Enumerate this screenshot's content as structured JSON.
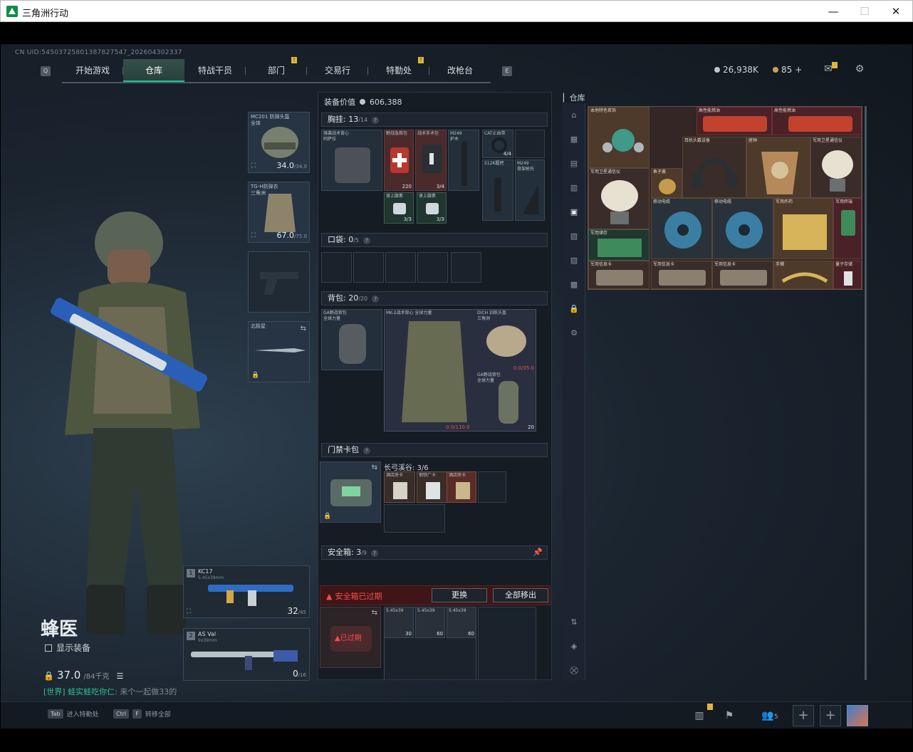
{
  "window": {
    "title": "三角洲行动",
    "min": "—",
    "max": "☐",
    "close": "✕"
  },
  "uid": "CN UID:54503725801387827547_202604302337",
  "nav": {
    "left_key": "Q",
    "right_key": "E",
    "tabs": [
      {
        "label": "开始游戏"
      },
      {
        "label": "仓库"
      },
      {
        "label": "特战干员"
      },
      {
        "label": "部门"
      },
      {
        "label": "交易行"
      },
      {
        "label": "特勤处"
      },
      {
        "label": "改枪台"
      }
    ]
  },
  "currency": {
    "hafcoin": "26,938K",
    "premium": "85"
  },
  "operator": {
    "name": "蜂医",
    "show_equipment": "显示装备",
    "weight": "37.0",
    "weight_max": "/84千克"
  },
  "chat": {
    "channel": "[世界]",
    "sender": "蛙实蛙吃你仁:",
    "message": "来个一起做33的"
  },
  "equipment_slots": [
    {
      "name": "MC201 防弹头盔\n全体",
      "durability": "34.0",
      "durability_max": "/34.0"
    },
    {
      "name": "TG-H防弹衣\n三角洲",
      "durability": "67.0",
      "durability_max": "/75.0"
    },
    {
      "name": ""
    },
    {
      "name": "北极星"
    }
  ],
  "weapons": [
    {
      "slot": "1",
      "name": "KC17",
      "ammo_type": "5.45x39mm",
      "ammo": "32",
      "ammo_max": "/45"
    },
    {
      "slot": "2",
      "name": "AS Val",
      "ammo_type": "9x39mm",
      "ammo": "0",
      "ammo_max": "/16"
    }
  ],
  "loadout": {
    "value_label": "装备价值",
    "value": "606,388",
    "chest_rig": {
      "label": "胸挂:",
      "count": "13",
      "max": "/14"
    },
    "pockets": {
      "label": "口袋:",
      "count": "0",
      "max": "/5"
    },
    "backpack": {
      "label": "背包:",
      "count": "20",
      "max": "/20"
    },
    "keycard": {
      "label": "门禁卡包",
      "location": "长弓溪谷: 3/6"
    },
    "safebox": {
      "label": "安全箱:",
      "count": "3",
      "max": "/9",
      "expired": "安全箱已过期",
      "change": "更换",
      "move_all": "全部移出",
      "expired_badge": "已过期"
    }
  },
  "rig_items": [
    {
      "name": "强袭战术背心\n阿萨拉"
    },
    {
      "name": "野战急救包",
      "count": "220"
    },
    {
      "name": "战术手术包",
      "count": "3/4"
    },
    {
      "name": "M249\n护木"
    },
    {
      "name": "CAT止血带",
      "count": "4/4"
    },
    {
      "name": ""
    },
    {
      "name": "512K握把"
    },
    {
      "name": "M249\n骨架枪托"
    },
    {
      "name": "肾上腺素",
      "count": "3/3"
    },
    {
      "name": "肾上腺素",
      "count": "3/3"
    }
  ],
  "backpack_items": [
    {
      "name": "GA野战背包\n全球力量"
    },
    {
      "name": "MK-2战术背心\n全球力量"
    },
    {
      "name": "DICH 训练头盔\n三角洲",
      "count": "0.0/35.0"
    },
    {
      "name": "GA野战背包\n全球力量",
      "count": "20"
    },
    {
      "name": "",
      "count": "0.0/110.0"
    }
  ],
  "keycards": [
    {
      "name": "酒店房卡"
    },
    {
      "name": "钢铁厂卡"
    },
    {
      "name": "酒店房卡"
    }
  ],
  "safebox_items": [
    {
      "name": "5.45x39\n",
      "count": "30"
    },
    {
      "name": "5.45x39\n",
      "count": "60"
    },
    {
      "name": "5.45x39\n",
      "count": "60"
    }
  ],
  "stash": {
    "label": "仓库",
    "items": [
      {
        "name": "本地特色首饰"
      },
      {
        "name": "高性能燃油"
      },
      {
        "name": "高性能燃油"
      },
      {
        "name": "军用卫星通信仪"
      },
      {
        "name": "鱼子酱"
      },
      {
        "name": "耳机头戴设备"
      },
      {
        "name": "座钟"
      },
      {
        "name": "军用卫星通信仪"
      },
      {
        "name": "军用储存"
      },
      {
        "name": "移动电缆"
      },
      {
        "name": "移动电缆"
      },
      {
        "name": "军用炸药"
      },
      {
        "name": "军用终端"
      },
      {
        "name": "军用信息卡"
      },
      {
        "name": "军用信息卡"
      },
      {
        "name": "军用信息卡"
      },
      {
        "name": "手镯"
      },
      {
        "name": "量子存储"
      }
    ]
  },
  "bottom": {
    "k1": "Tab",
    "k1_label": "进入特勤处",
    "k2a": "Ctrl",
    "k2b": "F",
    "k2_label": "转移全部",
    "party_count": "5"
  }
}
